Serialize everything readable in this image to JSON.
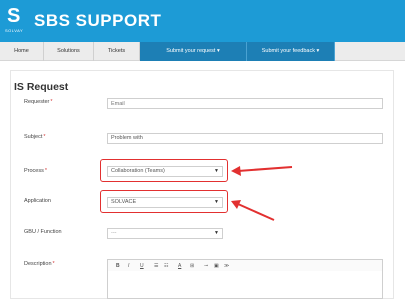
{
  "header": {
    "logo_letter": "S",
    "logo_subtext": "SOLVAY",
    "title": "SBS SUPPORT"
  },
  "nav": {
    "items": [
      {
        "label": "Home"
      },
      {
        "label": "Solutions"
      },
      {
        "label": "Tickets"
      },
      {
        "label": "Submit your request ▾"
      },
      {
        "label": "Submit your feedback ▾"
      }
    ]
  },
  "form": {
    "title": "IS Request",
    "required_mark": "*",
    "fields": {
      "requester": {
        "label": "Requester",
        "placeholder": "Email"
      },
      "subject": {
        "label": "Subject",
        "value": "Problem with"
      },
      "process": {
        "label": "Process",
        "value": "Collaboration (Teams)"
      },
      "application": {
        "label": "Application",
        "value": "SOLVACE"
      },
      "gbu": {
        "label": "GBU / Function",
        "value": "---"
      },
      "description": {
        "label": "Description"
      }
    },
    "toolbar": {
      "bold": "B",
      "italic": "I",
      "underline": "U",
      "list1": "☰",
      "list2": "☷",
      "font_color": "A",
      "table": "⊞",
      "link": "⊸",
      "image": "▣",
      "embed": "≫"
    }
  },
  "colors": {
    "header_bg": "#1d9bd6",
    "nav_active_bg": "#1d7fb5",
    "highlight": "#e23030",
    "required": "#d43838"
  }
}
